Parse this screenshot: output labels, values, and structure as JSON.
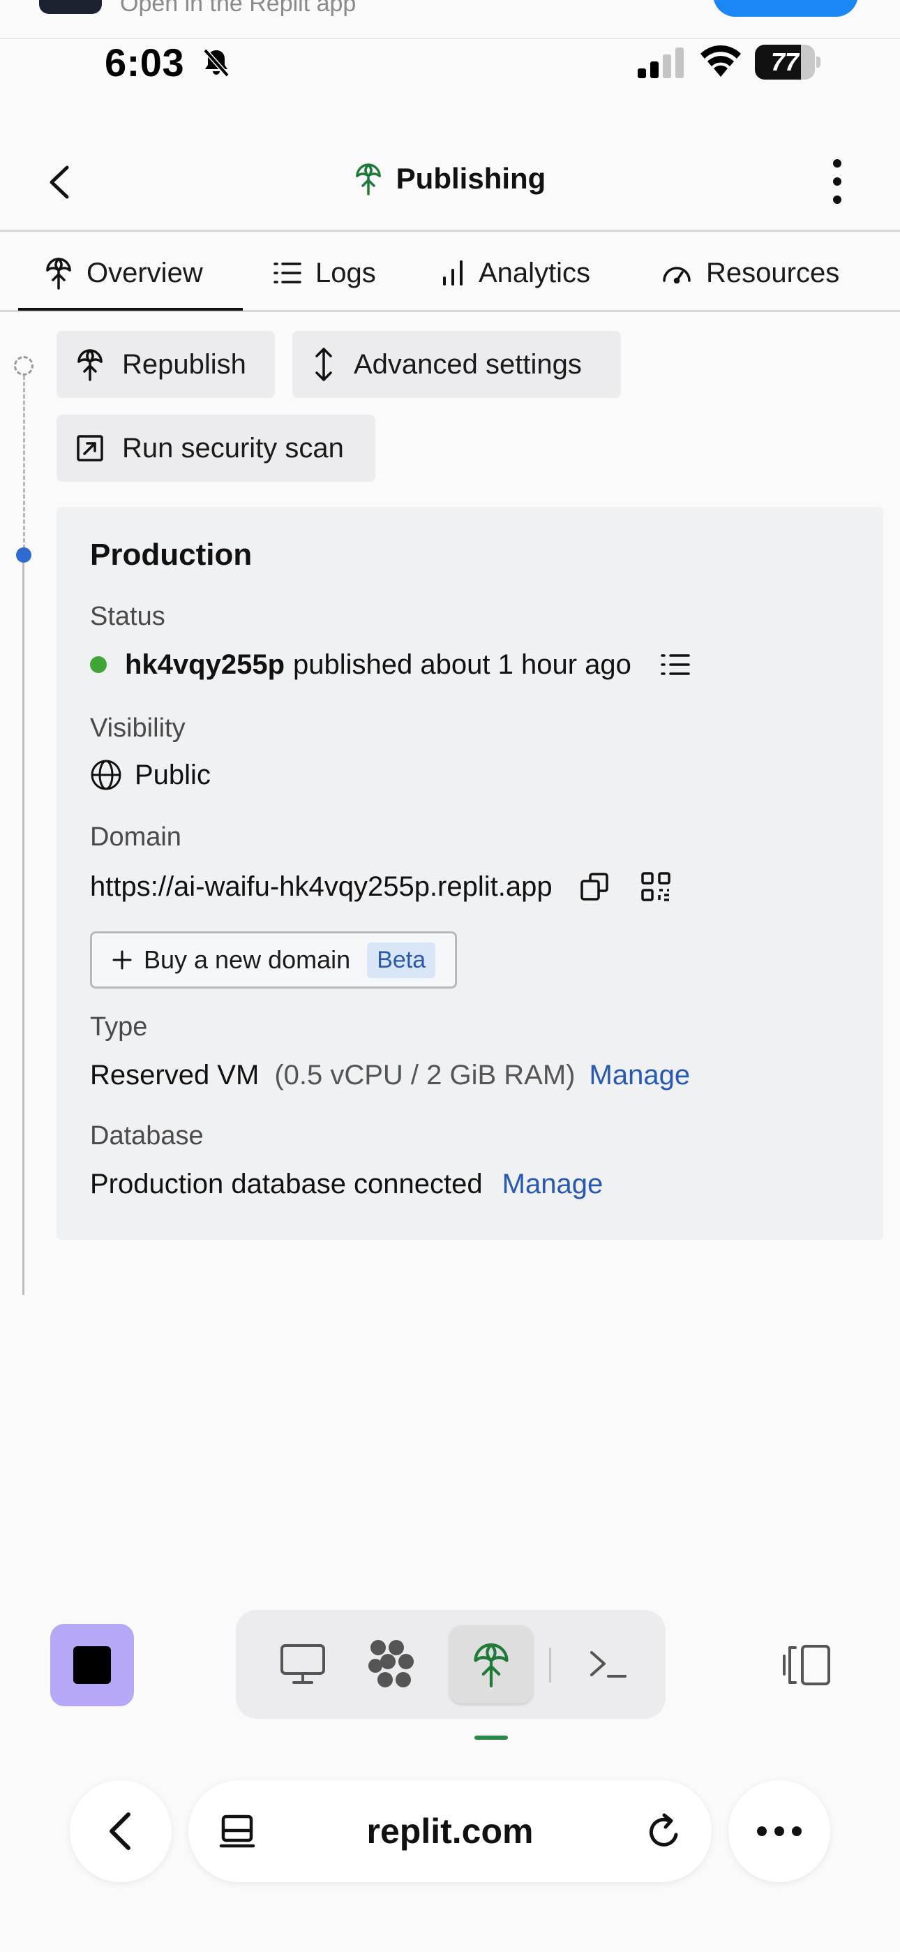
{
  "banner": {
    "text": "Open in the Replit app"
  },
  "statusbar": {
    "time": "6:03",
    "battery": "77",
    "battery_level": 0.77
  },
  "header": {
    "title": "Publishing"
  },
  "tabs": [
    {
      "label": "Overview",
      "icon": "publish-icon",
      "active": true
    },
    {
      "label": "Logs",
      "icon": "list-icon"
    },
    {
      "label": "Analytics",
      "icon": "bar-chart-icon"
    },
    {
      "label": "Resources",
      "icon": "gauge-icon"
    }
  ],
  "actions": {
    "republish": "Republish",
    "advanced_settings": "Advanced settings",
    "security_scan": "Run security scan"
  },
  "production": {
    "title": "Production",
    "status_label": "Status",
    "status_id": "hk4vqy255p",
    "status_text": "published about 1 hour ago",
    "visibility_label": "Visibility",
    "visibility_value": "Public",
    "domain_label": "Domain",
    "domain_value": "https://ai-waifu-hk4vqy255p.replit.app",
    "buy_domain": "Buy a new domain",
    "beta": "Beta",
    "type_label": "Type",
    "type_value": "Reserved VM",
    "type_detail": "(0.5 vCPU / 2 GiB RAM)",
    "type_manage": "Manage",
    "database_label": "Database",
    "database_value": "Production database connected",
    "database_manage": "Manage"
  },
  "browser": {
    "url": "replit.com"
  },
  "colors": {
    "accent_link": "#2759b4",
    "status_green": "#3fa535",
    "timeline_blue": "#2f6ad0",
    "stop_purple": "#b6a8f6",
    "publish_green": "#1f7a3a"
  }
}
